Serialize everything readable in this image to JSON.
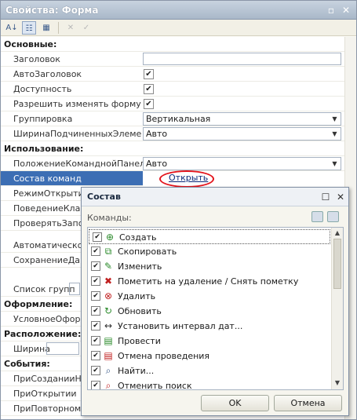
{
  "window": {
    "title": "Свойства: Форма"
  },
  "sections": {
    "main": "Основные:",
    "usage": "Использование:",
    "design": "Оформление:",
    "layout": "Расположение:",
    "events": "События:"
  },
  "props": {
    "header": "Заголовок",
    "autoheader": "АвтоЗаголовок",
    "availability": "Доступность",
    "allow_change": "Разрешить изменять форму",
    "grouping": "Группировка",
    "grouping_val": "Вертикальная",
    "child_width": "ШиринаПодчиненныхЭлементов",
    "child_width_val": "Авто",
    "panel_pos": "ПоложениеКоманднойПанели",
    "panel_pos_val": "Авто",
    "commands": "Состав команд",
    "commands_val": "Открыть",
    "open_mode": "РежимОткрытия",
    "key_behavior": "ПоведениеКлави",
    "check_fill": "ПроверятьЗапол",
    "auto": "Автоматическое",
    "save_data": "СохранениеДан",
    "group_list": "Список групп",
    "cond_design": "УсловноеОформ",
    "width": "Ширина",
    "on_create": "ПриСозданииНа",
    "on_open": "ПриОткрытии",
    "on_reopen": "ПриПовторномО"
  },
  "dialog": {
    "title": "Состав",
    "commands_label": "Команды:",
    "items": [
      {
        "label": "Создать",
        "icon": "create-icon"
      },
      {
        "label": "Скопировать",
        "icon": "copy-icon"
      },
      {
        "label": "Изменить",
        "icon": "pencil-icon"
      },
      {
        "label": "Пометить на удаление / Снять пометку",
        "icon": "delete-mark-icon"
      },
      {
        "label": "Удалить",
        "icon": "delete-icon"
      },
      {
        "label": "Обновить",
        "icon": "refresh-icon"
      },
      {
        "label": "Установить интервал дат...",
        "icon": "date-interval-icon"
      },
      {
        "label": "Провести",
        "icon": "post-icon"
      },
      {
        "label": "Отмена проведения",
        "icon": "unpost-icon"
      },
      {
        "label": "Найти...",
        "icon": "find-icon"
      },
      {
        "label": "Отменить поиск",
        "icon": "cancel-search-icon"
      }
    ],
    "ok": "OK",
    "cancel": "Отмена"
  },
  "colors": {
    "selection": "#3c6eb4",
    "highlight": "#e3141c"
  }
}
